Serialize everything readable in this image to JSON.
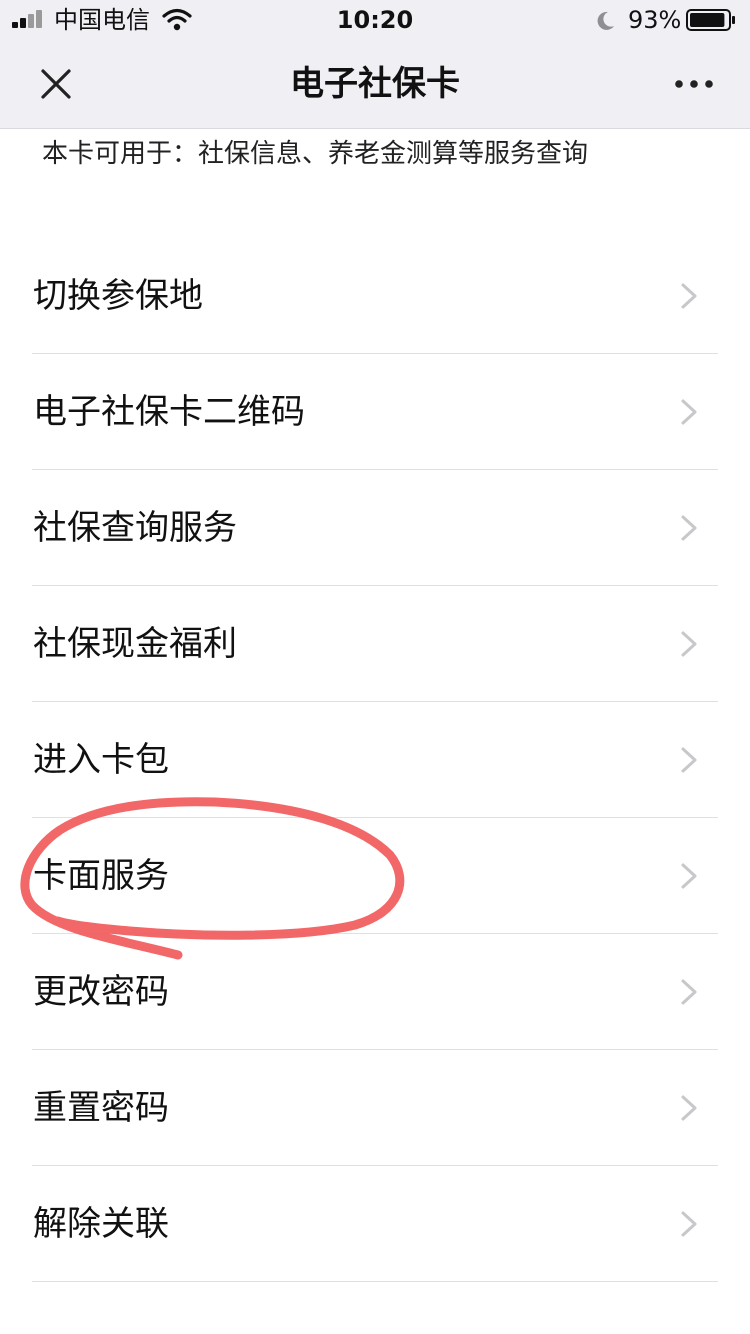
{
  "status_bar": {
    "carrier": "中国电信",
    "time": "10:20",
    "battery_percent": "93%",
    "battery_level": 0.93
  },
  "nav": {
    "title": "电子社保卡",
    "close_icon": "close-icon",
    "more_icon": "more-icon"
  },
  "subtitle": "本卡可用于：社保信息、养老金测算等服务查询",
  "menu": {
    "items": [
      {
        "label": "切换参保地"
      },
      {
        "label": "电子社保卡二维码"
      },
      {
        "label": "社保查询服务"
      },
      {
        "label": "社保现金福利"
      },
      {
        "label": "进入卡包"
      },
      {
        "label": "卡面服务"
      },
      {
        "label": "更改密码"
      },
      {
        "label": "重置密码"
      },
      {
        "label": "解除关联"
      }
    ]
  },
  "colors": {
    "nav_background": "#efeff4",
    "text": "#111111",
    "chevron": "#c7c7cc",
    "separator": "#e0e0e0",
    "annotation_circle": "#f15a5a"
  }
}
